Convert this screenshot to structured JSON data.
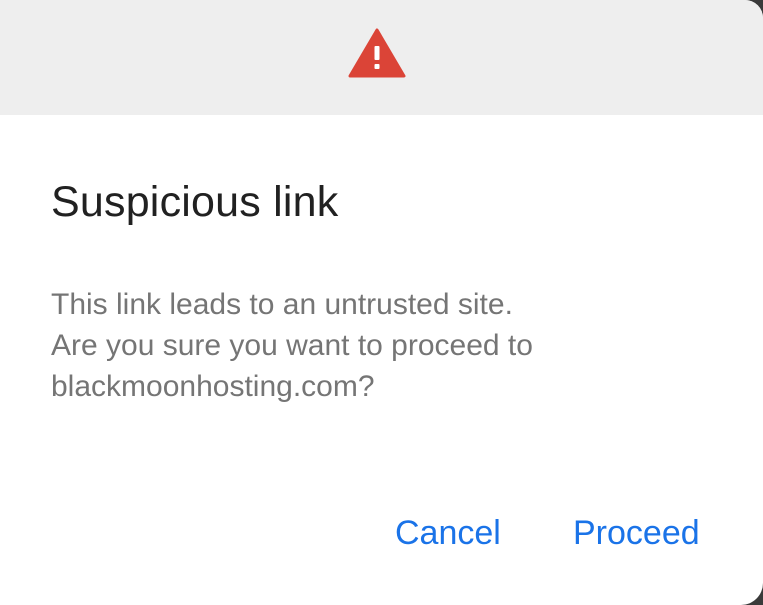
{
  "dialog": {
    "icon": "warning-triangle-icon",
    "header_color": "#eeeeee",
    "icon_color": "#db4437",
    "title": "Suspicious link",
    "message_lines": [
      "This link leads to an untrusted site.",
      "Are you sure you want to proceed to",
      "blackmoonhosting.com?"
    ],
    "cancel_label": "Cancel",
    "proceed_label": "Proceed",
    "button_color": "#1a73e8"
  }
}
